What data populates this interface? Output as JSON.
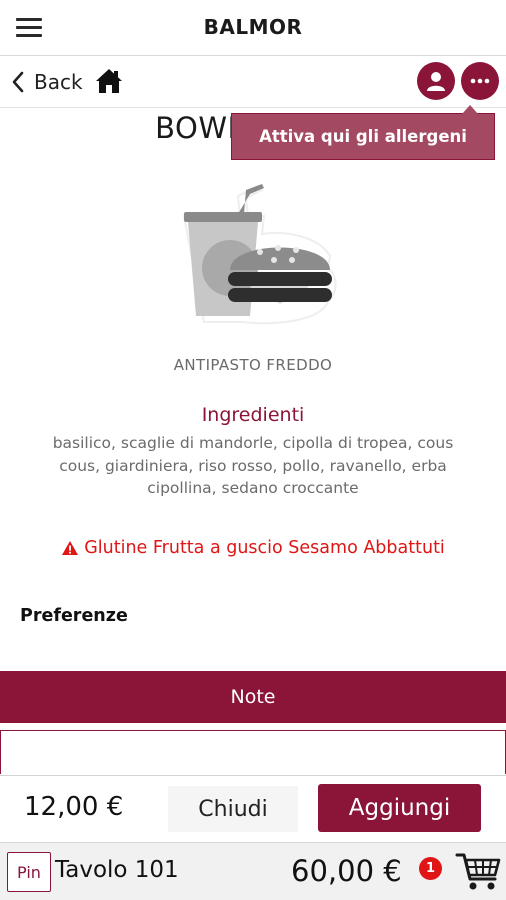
{
  "header": {
    "title": "BALMOR",
    "menu_icon": "hamburger-menu-icon"
  },
  "nav": {
    "back_label": "Back",
    "home_icon": "home-icon",
    "user_icon": "user-icon",
    "more_icon": "more-options-icon"
  },
  "tooltip": {
    "text": "Attiva qui gli allergeni"
  },
  "dish": {
    "name": "BOWL POLLO",
    "image_icon": "drink-burger-placeholder-icon",
    "category": "ANTIPASTO FREDDO",
    "ingredients_heading": "Ingredienti",
    "ingredients": "basilico, scaglie di mandorle, cipolla di tropea, cous cous, giardiniera, riso rosso, pollo, ravanello, erba cipollina, sedano croccante",
    "allergens": "Glutine Frutta a guscio Sesamo Abbattuti",
    "allergen_icon": "warning-icon"
  },
  "preferences": {
    "label": "Preferenze"
  },
  "note": {
    "label": "Note",
    "value": "",
    "placeholder": ""
  },
  "actions": {
    "price": "12,00 €",
    "close_label": "Chiudi",
    "add_label": "Aggiungi"
  },
  "footer": {
    "pin_label": "Pin",
    "table_label": "Tavolo 101",
    "total": "60,00 €",
    "cart_count": "1",
    "cart_icon": "shopping-cart-icon"
  },
  "colors": {
    "accent": "#8b1538",
    "tooltip_bg": "#a34962",
    "warning": "#e01515"
  }
}
